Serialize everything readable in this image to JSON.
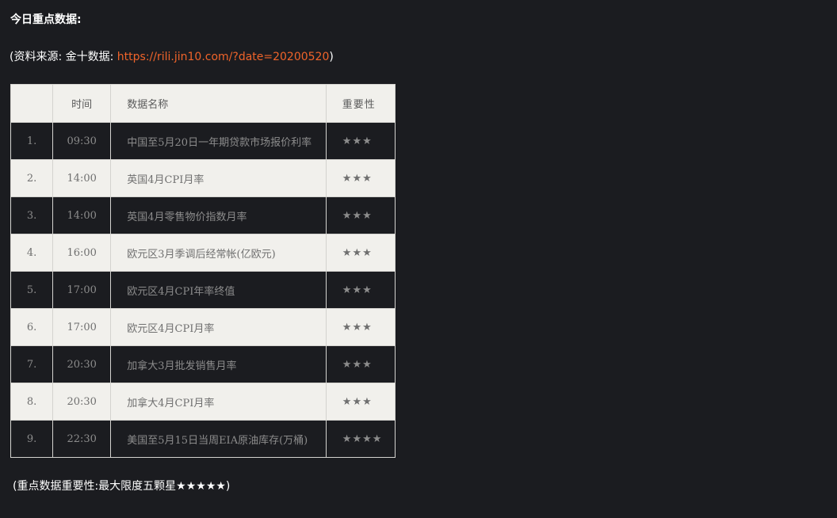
{
  "title": "今日重点数据:",
  "source": {
    "prefix": "(资料来源: 金十数据: ",
    "link_text": "https://rili.jin10.com/?date=20200520",
    "suffix": ")"
  },
  "table": {
    "headers": {
      "index": "",
      "time": "时间",
      "name": "数据名称",
      "importance": "重要性"
    },
    "rows": [
      {
        "index": "1.",
        "time": "09:30",
        "name": "中国至5月20日一年期贷款市场报价利率",
        "stars": "★★★"
      },
      {
        "index": "2.",
        "time": "14:00",
        "name": "英国4月CPI月率",
        "stars": "★★★"
      },
      {
        "index": "3.",
        "time": "14:00",
        "name": "英国4月零售物价指数月率",
        "stars": "★★★"
      },
      {
        "index": "4.",
        "time": "16:00",
        "name": "欧元区3月季调后经常帐(亿欧元)",
        "stars": "★★★"
      },
      {
        "index": "5.",
        "time": "17:00",
        "name": "欧元区4月CPI年率终值",
        "stars": "★★★"
      },
      {
        "index": "6.",
        "time": "17:00",
        "name": "欧元区4月CPI月率",
        "stars": "★★★"
      },
      {
        "index": "7.",
        "time": "20:30",
        "name": "加拿大3月批发销售月率",
        "stars": "★★★"
      },
      {
        "index": "8.",
        "time": "20:30",
        "name": "加拿大4月CPI月率",
        "stars": "★★★"
      },
      {
        "index": "9.",
        "time": "22:30",
        "name": "美国至5月15日当周EIA原油库存(万桶)",
        "stars": "★★★★"
      }
    ]
  },
  "footnote": "(重点数据重要性:最大限度五颗星★★★★★)",
  "colors": {
    "background": "#1b1c20",
    "link": "#f0642a",
    "light_row": "#f1f0ec"
  }
}
